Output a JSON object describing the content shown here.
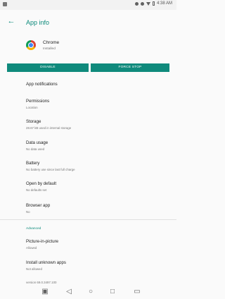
{
  "status_bar": {
    "time": "4:38 AM"
  },
  "app_bar": {
    "title": "App info",
    "back_icon": "arrow-back-icon"
  },
  "app": {
    "name": "Chrome",
    "status": "Installed",
    "icon": "chrome-icon"
  },
  "buttons": {
    "disable": "DISABLE",
    "force_stop": "FORCE STOP"
  },
  "settings": [
    {
      "title": "App notifications",
      "subtitle": ""
    },
    {
      "title": "Permissions",
      "subtitle": "Location"
    },
    {
      "title": "Storage",
      "subtitle": "28.67 kB used in internal storage"
    },
    {
      "title": "Data usage",
      "subtitle": "No data used"
    },
    {
      "title": "Battery",
      "subtitle": "No battery use since last full charge"
    },
    {
      "title": "Open by default",
      "subtitle": "No defaults set"
    },
    {
      "title": "Browser app",
      "subtitle": "No"
    }
  ],
  "advanced": {
    "label": "Advanced",
    "items": [
      {
        "title": "Picture-in-picture",
        "subtitle": "Allowed"
      },
      {
        "title": "Install unknown apps",
        "subtitle": "Not allowed"
      }
    ]
  },
  "version": "version 69.0.3497.100",
  "nav": {
    "icons": [
      "recent-apps-icon",
      "back-icon",
      "home-icon",
      "overview-icon",
      "rotate-icon"
    ]
  },
  "colors": {
    "accent": "#0c8a7b",
    "button": "#0f8a7c"
  }
}
